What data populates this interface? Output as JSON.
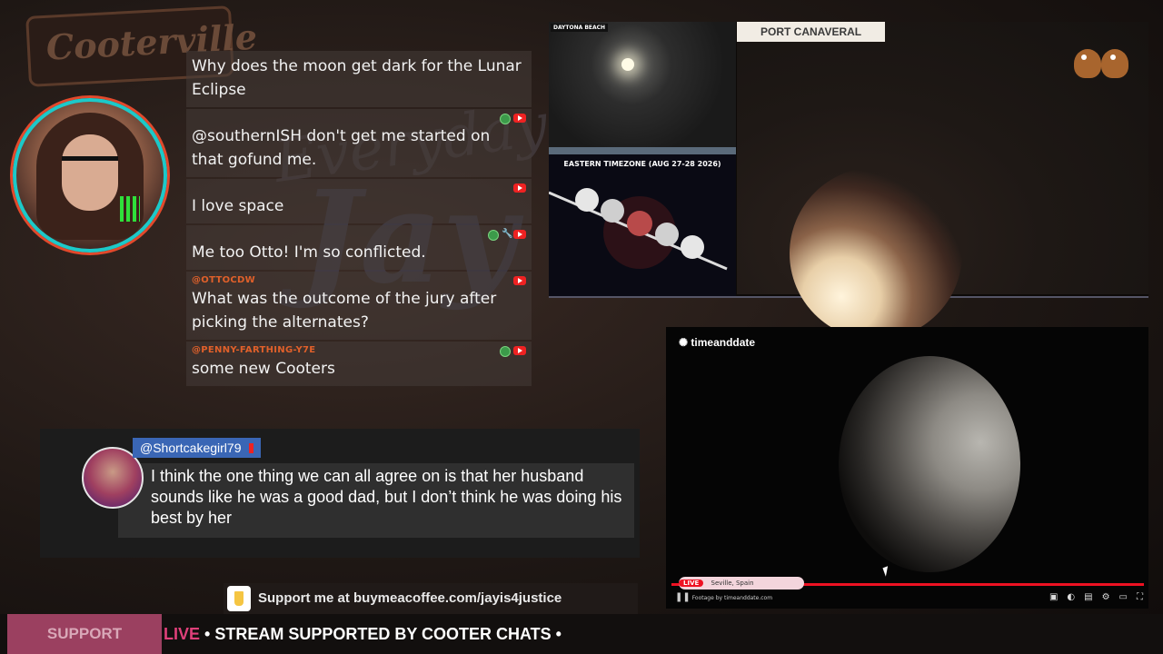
{
  "background": {
    "sign_text": "Cooterville"
  },
  "chat": {
    "messages": [
      {
        "user": "",
        "text": "Why does the moon get dark for the Lunar Eclipse",
        "user_color": "#e24040"
      },
      {
        "user": "",
        "text": "@southernISH don't get me started on that gofund me.",
        "user_color": "#d23030"
      },
      {
        "user": "",
        "text": "I love space",
        "user_color": "#3a6ad8"
      },
      {
        "user": "",
        "text": "Me too Otto! I'm so conflicted.",
        "user_color": "#d23030"
      },
      {
        "user": "@OTTOCDW",
        "text": "What was the outcome of the jury after picking the alternates?",
        "user_color": "#e0602a"
      },
      {
        "user": "@PENNY-FARTHING-Y7E",
        "text": "some new Cooters",
        "user_color": "#e0602a"
      }
    ]
  },
  "feed": {
    "daytona_label": "DAYTONA BEACH",
    "eclipse_title": "EASTERN TIMEZONE (AUG 27-28 2026)",
    "port_label": "PORT CANAVERAL"
  },
  "timeanddate": {
    "logo": "timeanddate",
    "live_badge": "LIVE",
    "location": "Seville, Spain",
    "footer": "Footage by timeanddate.com"
  },
  "highlight": {
    "username": "@Shortcakegirl79",
    "text": "I think the one thing we can all agree on is that her husband sounds like he was a good dad, but I don’t think he was doing his best by her"
  },
  "coffee": {
    "text": "Support me at buymeacoffee.com/jayis4justice"
  },
  "ticker": {
    "support_label": "SUPPORT",
    "live": "LIVE",
    "text": " • STREAM SUPPORTED BY COOTER CHATS •"
  },
  "colors": {
    "avatar_ring": "#1cc9c9",
    "support_bg": "#9b4060",
    "highlight_name_bg": "#3a66b5",
    "live_red": "#e12222"
  }
}
